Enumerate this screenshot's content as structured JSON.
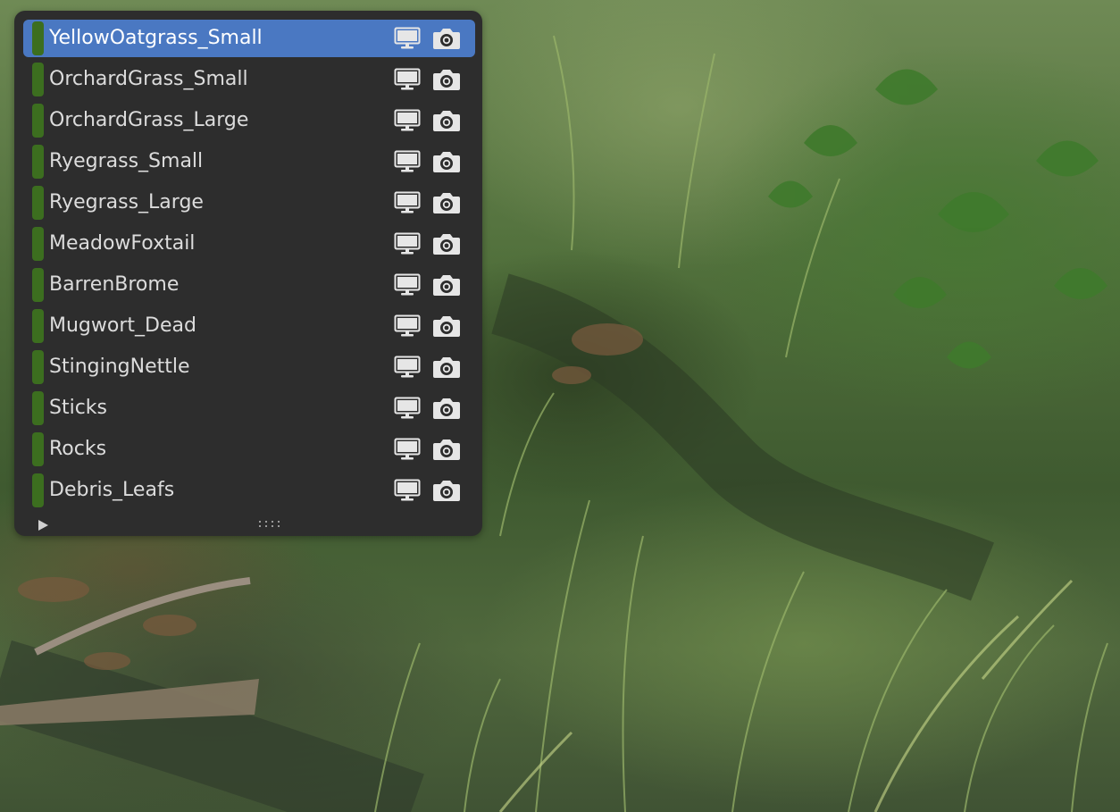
{
  "panel": {
    "accent_color": "#4a78c2",
    "tag_color": "#3c6e1f",
    "items": [
      {
        "label": "YellowOatgrass_Small",
        "active": true
      },
      {
        "label": "OrchardGrass_Small",
        "active": false
      },
      {
        "label": "OrchardGrass_Large",
        "active": false
      },
      {
        "label": "Ryegrass_Small",
        "active": false
      },
      {
        "label": "Ryegrass_Large",
        "active": false
      },
      {
        "label": "MeadowFoxtail",
        "active": false
      },
      {
        "label": "BarrenBrome",
        "active": false
      },
      {
        "label": "Mugwort_Dead",
        "active": false
      },
      {
        "label": "StingingNettle",
        "active": false
      },
      {
        "label": "Sticks",
        "active": false
      },
      {
        "label": "Rocks",
        "active": false
      },
      {
        "label": "Debris_Leafs",
        "active": false
      }
    ],
    "icons": {
      "viewport": "monitor-icon",
      "render": "camera-icon",
      "expand": "triangle-right-icon",
      "grip": "drag-grip-icon"
    }
  }
}
